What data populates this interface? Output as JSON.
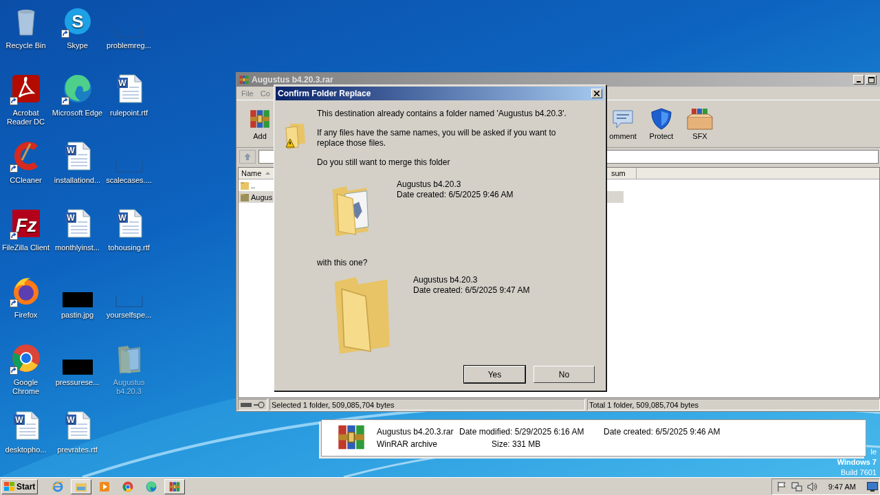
{
  "desktop_icons": [
    {
      "label": "Recycle Bin",
      "kind": "recycle",
      "shortcut": false,
      "dimmed": false
    },
    {
      "label": "Skype",
      "kind": "skype",
      "glyph": "S",
      "shortcut": true,
      "dimmed": false
    },
    {
      "label": "problemreg...",
      "kind": "blank",
      "shortcut": false,
      "dimmed": false
    },
    {
      "label": "Acrobat Reader DC",
      "kind": "acrobat",
      "shortcut": true,
      "dimmed": false
    },
    {
      "label": "Microsoft Edge",
      "kind": "edge",
      "shortcut": true,
      "dimmed": false
    },
    {
      "label": "rulepoint.rtf",
      "kind": "word",
      "glyph": "W",
      "shortcut": false,
      "dimmed": false
    },
    {
      "label": "CCleaner",
      "kind": "ccleaner",
      "shortcut": true,
      "dimmed": false
    },
    {
      "label": "installationd...",
      "kind": "word",
      "glyph": "W",
      "shortcut": false,
      "dimmed": false
    },
    {
      "label": "scalecases....",
      "kind": "blank",
      "shortcut": false,
      "dimmed": false
    },
    {
      "label": "FileZilla Client",
      "kind": "filezilla",
      "glyph": "Fz",
      "shortcut": true,
      "dimmed": false
    },
    {
      "label": "monthlyinst...",
      "kind": "word",
      "glyph": "W",
      "shortcut": false,
      "dimmed": false
    },
    {
      "label": "tohousing.rtf",
      "kind": "word",
      "glyph": "W",
      "shortcut": false,
      "dimmed": false
    },
    {
      "label": "Firefox",
      "kind": "firefox",
      "shortcut": true,
      "dimmed": false
    },
    {
      "label": "pastin.jpg",
      "kind": "dark",
      "shortcut": false,
      "dimmed": false
    },
    {
      "label": "yourselfspe...",
      "kind": "blank",
      "shortcut": false,
      "dimmed": false
    },
    {
      "label": "Google Chrome",
      "kind": "chrome",
      "shortcut": true,
      "dimmed": false
    },
    {
      "label": "pressurese...",
      "kind": "dark",
      "shortcut": false,
      "dimmed": false
    },
    {
      "label": "Augustus b4.20.3",
      "kind": "folder",
      "shortcut": false,
      "dimmed": true
    },
    {
      "label": "desktopho...",
      "kind": "word",
      "glyph": "W",
      "shortcut": false,
      "dimmed": false
    },
    {
      "label": "prevrates.rtf",
      "kind": "word",
      "glyph": "W",
      "shortcut": false,
      "dimmed": false
    }
  ],
  "desktop_texts": {
    "edition_tail": "le",
    "os": "Windows 7",
    "build": "Build 7601"
  },
  "winrar": {
    "title": "Augustus b4.20.3.rar",
    "menu": [
      "File",
      "Co"
    ],
    "toolbar": [
      {
        "label": "Add",
        "kind": "add"
      },
      {
        "label": "omment",
        "kind": "comment"
      },
      {
        "label": "Protect",
        "kind": "protect"
      },
      {
        "label": "SFX",
        "kind": "sfx"
      }
    ],
    "columns": [
      "Name",
      "sum"
    ],
    "rows": [
      {
        "name": "..",
        "selected": false
      },
      {
        "name": "Augus",
        "selected": true
      }
    ],
    "status": {
      "selected": "Selected 1 folder, 509,085,704 bytes",
      "total": "Total 1 folder, 509,085,704 bytes"
    }
  },
  "dialog": {
    "title": "Confirm Folder Replace",
    "message": "This destination already contains a folder named 'Augustus b4.20.3'.",
    "note": "If any files have the same names, you will be asked if you want to replace those files.",
    "question": "Do you still want to merge this folder",
    "existing": {
      "name": "Augustus b4.20.3",
      "date": "Date created: 6/5/2025 9:46 AM"
    },
    "with_label": "with this one?",
    "incoming": {
      "name": "Augustus b4.20.3",
      "date": "Date created: 6/5/2025 9:47 AM"
    },
    "buttons": [
      "Yes",
      "No"
    ]
  },
  "info_tip": {
    "name": "Augustus b4.20.3.rar",
    "modified": "Date modified: 5/29/2025 6:16 AM",
    "created": "Date created: 6/5/2025 9:46 AM",
    "type": "WinRAR archive",
    "size": "Size: 331 MB"
  },
  "taskbar": {
    "start": "Start",
    "apps": [
      {
        "kind": "ie",
        "selected": false
      },
      {
        "kind": "explorer",
        "selected": true
      },
      {
        "kind": "media",
        "selected": false
      },
      {
        "kind": "chrome",
        "selected": false
      },
      {
        "kind": "edge",
        "selected": false
      },
      {
        "kind": "winrar",
        "selected": true
      }
    ],
    "clock": "9:47 AM"
  }
}
